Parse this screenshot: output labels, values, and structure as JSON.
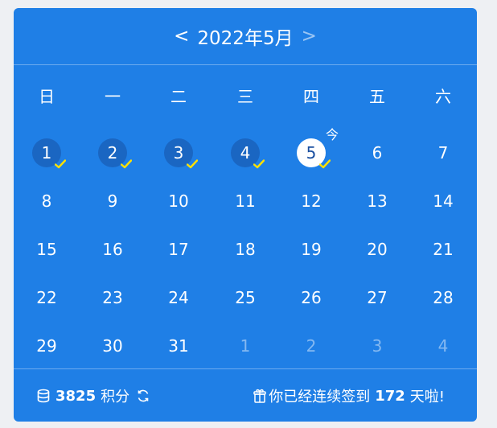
{
  "calendar": {
    "prev_symbol": "<",
    "title": "2022年5月",
    "next_symbol": ">",
    "weekdays": [
      "日",
      "一",
      "二",
      "三",
      "四",
      "五",
      "六"
    ],
    "today_mark": "今",
    "days": [
      {
        "n": "1",
        "state": "signed"
      },
      {
        "n": "2",
        "state": "signed"
      },
      {
        "n": "3",
        "state": "signed"
      },
      {
        "n": "4",
        "state": "signed"
      },
      {
        "n": "5",
        "state": "today"
      },
      {
        "n": "6",
        "state": "normal"
      },
      {
        "n": "7",
        "state": "normal"
      },
      {
        "n": "8",
        "state": "normal"
      },
      {
        "n": "9",
        "state": "normal"
      },
      {
        "n": "10",
        "state": "normal"
      },
      {
        "n": "11",
        "state": "normal"
      },
      {
        "n": "12",
        "state": "normal"
      },
      {
        "n": "13",
        "state": "normal"
      },
      {
        "n": "14",
        "state": "normal"
      },
      {
        "n": "15",
        "state": "normal"
      },
      {
        "n": "16",
        "state": "normal"
      },
      {
        "n": "17",
        "state": "normal"
      },
      {
        "n": "18",
        "state": "normal"
      },
      {
        "n": "19",
        "state": "normal"
      },
      {
        "n": "20",
        "state": "normal"
      },
      {
        "n": "21",
        "state": "normal"
      },
      {
        "n": "22",
        "state": "normal"
      },
      {
        "n": "23",
        "state": "normal"
      },
      {
        "n": "24",
        "state": "normal"
      },
      {
        "n": "25",
        "state": "normal"
      },
      {
        "n": "26",
        "state": "normal"
      },
      {
        "n": "27",
        "state": "normal"
      },
      {
        "n": "28",
        "state": "normal"
      },
      {
        "n": "29",
        "state": "normal"
      },
      {
        "n": "30",
        "state": "normal"
      },
      {
        "n": "31",
        "state": "normal"
      },
      {
        "n": "1",
        "state": "other"
      },
      {
        "n": "2",
        "state": "other"
      },
      {
        "n": "3",
        "state": "other"
      },
      {
        "n": "4",
        "state": "other"
      }
    ]
  },
  "footer": {
    "points_icon": "database-icon",
    "points_value": "3825",
    "points_label": "积分",
    "refresh_icon": "refresh-icon",
    "streak_icon": "gift-icon",
    "streak_prefix": "你已经连续签到",
    "streak_days": "172",
    "streak_suffix": "天啦!"
  },
  "colors": {
    "background": "#1f7fe6",
    "signed_circle": "#1a66c2",
    "check": "#ffe100",
    "today_circle": "#ffffff"
  }
}
